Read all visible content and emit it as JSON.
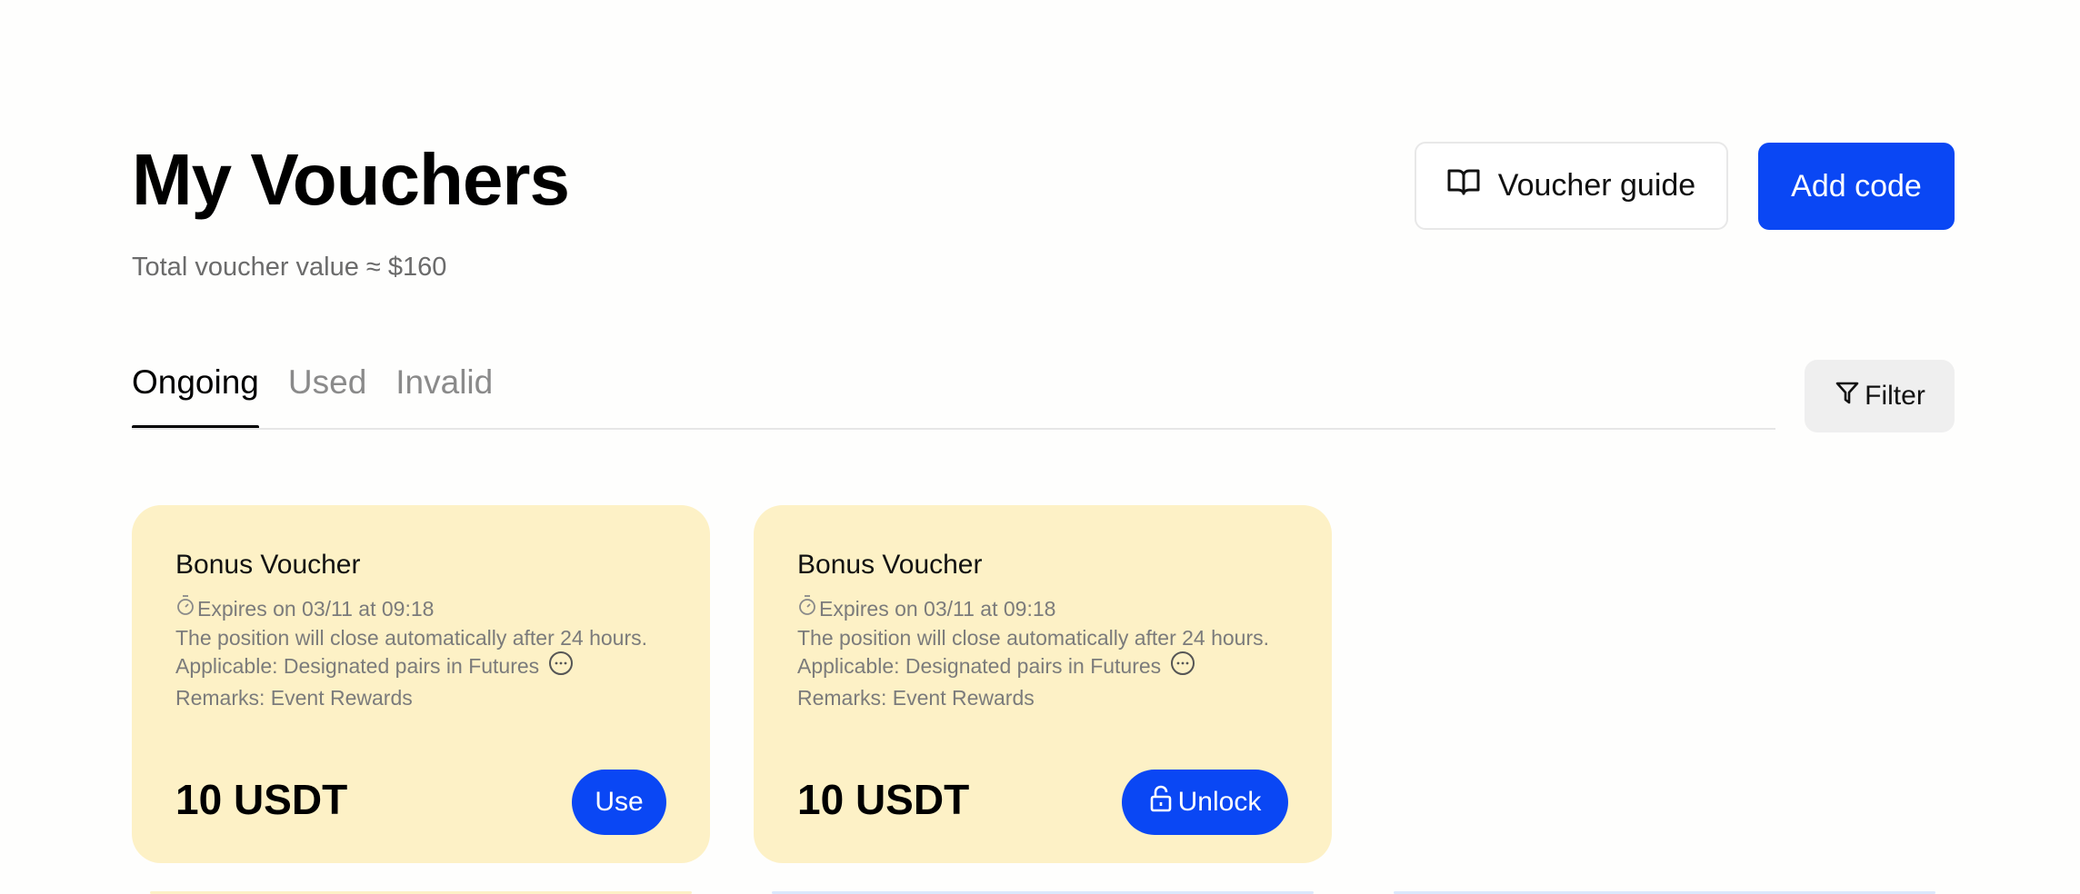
{
  "header": {
    "title": "My Vouchers",
    "total_label": "Total voucher value ≈ $160",
    "guide_label": "Voucher guide",
    "add_label": "Add code"
  },
  "tabs": [
    {
      "label": "Ongoing",
      "active": true
    },
    {
      "label": "Used",
      "active": false
    },
    {
      "label": "Invalid",
      "active": false
    }
  ],
  "filter": {
    "label": "Filter"
  },
  "vouchers": [
    {
      "title": "Bonus Voucher",
      "expiry": "Expires on 03/11 at 09:18",
      "desc": "The position will close automatically after 24 hours.",
      "applicable": "Applicable: Designated pairs in Futures",
      "remarks": "Remarks: Event Rewards",
      "amount": "10 USDT",
      "action": "Use"
    },
    {
      "title": "Bonus Voucher",
      "expiry": "Expires on 03/11 at 09:18",
      "desc": "The position will close automatically after 24 hours.",
      "applicable": "Applicable: Designated pairs in Futures",
      "remarks": "Remarks: Event Rewards",
      "amount": "10 USDT",
      "action": "Unlock"
    }
  ],
  "colors": {
    "primary": "#0a47f4",
    "card_bg": "#fdf1c6",
    "muted_text": "#7b7b7b"
  },
  "icons": [
    "book-icon",
    "filter-icon",
    "stopwatch-icon",
    "more-icon",
    "lock-icon"
  ]
}
